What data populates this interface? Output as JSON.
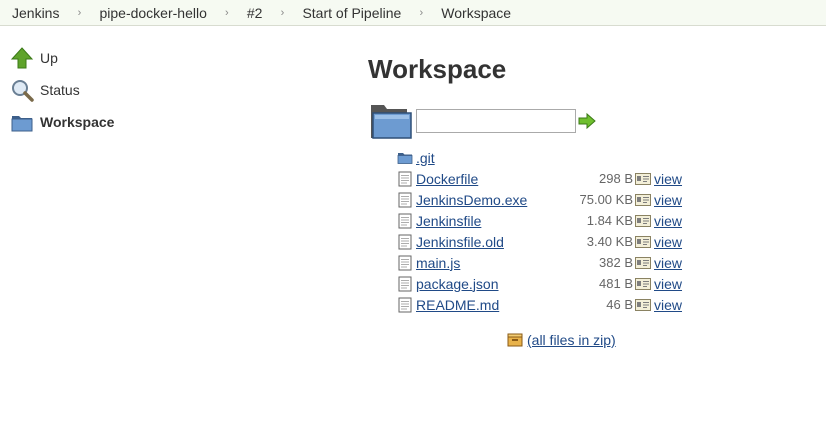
{
  "breadcrumbs": [
    {
      "label": "Jenkins"
    },
    {
      "label": "pipe-docker-hello"
    },
    {
      "label": "#2"
    },
    {
      "label": "Start of Pipeline"
    },
    {
      "label": "Workspace"
    }
  ],
  "breadcrumb_separator": "›",
  "sidebar": {
    "items": [
      {
        "label": "Up",
        "icon": "up-arrow-icon"
      },
      {
        "label": "Status",
        "icon": "magnifier-icon"
      },
      {
        "label": "Workspace",
        "icon": "folder-icon"
      }
    ]
  },
  "main": {
    "title": "Workspace",
    "path_input": {
      "value": ""
    },
    "files": [
      {
        "name": ".git",
        "type": "folder",
        "size": "",
        "view": ""
      },
      {
        "name": "Dockerfile",
        "type": "file",
        "size": "298 B",
        "view": "view"
      },
      {
        "name": "JenkinsDemo.exe",
        "type": "file",
        "size": "75.00 KB",
        "view": "view"
      },
      {
        "name": "Jenkinsfile",
        "type": "file",
        "size": "1.84 KB",
        "view": "view"
      },
      {
        "name": "Jenkinsfile.old",
        "type": "file",
        "size": "3.40 KB",
        "view": "view"
      },
      {
        "name": "main.js",
        "type": "file",
        "size": "382 B",
        "view": "view"
      },
      {
        "name": "package.json",
        "type": "file",
        "size": "481 B",
        "view": "view"
      },
      {
        "name": "README.md",
        "type": "file",
        "size": "46 B",
        "view": "view"
      }
    ],
    "zip_link": "(all files in zip)"
  },
  "colors": {
    "link": "#204a87",
    "breadcrumb_bg": "#f6faf2",
    "folder_blue": "#5b8dc9",
    "arrow_green": "#4e9a06"
  }
}
